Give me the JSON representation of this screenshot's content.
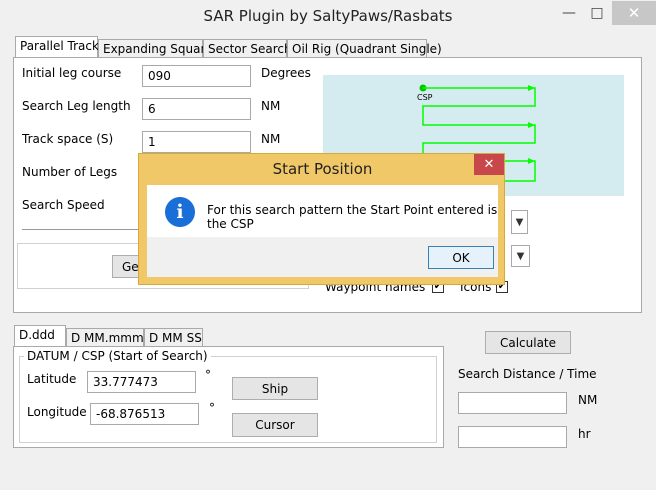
{
  "window": {
    "title": "SAR Plugin by SaltyPaws/Rasbats"
  },
  "pattern_tabs": [
    {
      "label": "Parallel Track"
    },
    {
      "label": "Expanding Square"
    },
    {
      "label": "Sector Search"
    },
    {
      "label": "Oil Rig (Quadrant Single)"
    }
  ],
  "params": {
    "initial_leg_course": {
      "label": "Initial leg course",
      "value": "090",
      "unit": "Degrees"
    },
    "search_leg_length": {
      "label": "Search Leg length",
      "value": "6",
      "unit": "NM"
    },
    "track_space": {
      "label": "Track space (S)",
      "value": "1",
      "unit": "NM"
    },
    "number_of_legs": {
      "label": "Number of Legs"
    },
    "search_speed": {
      "label": "Search Speed"
    }
  },
  "generate_button_partial": "Ge",
  "preview": {
    "csp_label": "CSP",
    "track_color": "#00ff00",
    "background": "#d4ebf0"
  },
  "options": {
    "waypoint_names": {
      "label": "Waypoint names",
      "checked": true
    },
    "icons": {
      "label": "Icons",
      "checked": true
    }
  },
  "coord_tabs": [
    {
      "label": "D.ddd"
    },
    {
      "label": "D MM.mmm"
    },
    {
      "label": "D MM SS"
    }
  ],
  "datum": {
    "group_label": "DATUM / CSP (Start of Search)",
    "latitude": {
      "label": "Latitude",
      "value": "33.777473",
      "unit": "°"
    },
    "longitude": {
      "label": "Longitude",
      "value": "-68.876513",
      "unit": "°"
    },
    "ship_button": "Ship",
    "cursor_button": "Cursor"
  },
  "results": {
    "calculate_button": "Calculate",
    "section_label": "Search Distance / Time",
    "distance_unit": "NM",
    "time_unit": "hr"
  },
  "dialog": {
    "title": "Start Position",
    "message": "For this search pattern the Start Point entered is the CSP",
    "ok_label": "OK"
  },
  "icons": {
    "info": "info-icon",
    "close": "close-icon",
    "minimize": "minimize-icon",
    "maximize": "maximize-icon",
    "dropdown": "chevron-down-icon"
  }
}
